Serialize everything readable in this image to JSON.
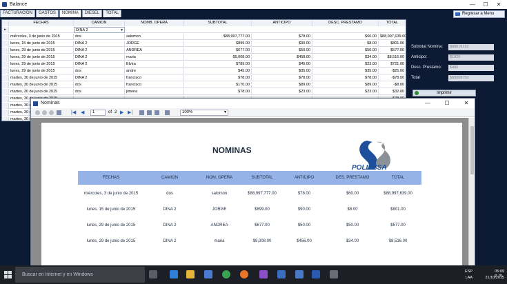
{
  "balance_window": {
    "title": "Balance",
    "tabs": [
      "FACTURACIÓN",
      "GASTOS",
      "NOMINA",
      "DIESEL",
      "TOTAL"
    ],
    "active_tab": 2,
    "regresar_label": "Regresar a Menu",
    "controls": {
      "minimize": "—",
      "maximize": "☐",
      "close": "✕"
    },
    "grid": {
      "columns": [
        "FECHAS",
        "CAMION",
        "NOMB. OPERA",
        "SUBTOTAL",
        "ANTICIPO",
        "DESC. PRESTAMO",
        "TOTAL"
      ],
      "filter_value": "DINA 2",
      "new_row_marker": "▸",
      "rows": [
        [
          "miércoles, 3 de junio de 2015",
          "dos",
          "salomon",
          "$88,997,777.00",
          "$78.00",
          "$60.00",
          "$88,997,639.00"
        ],
        [
          "lunes, 15 de junio de 2015",
          "DINA 2",
          "JORGE",
          "$899.00",
          "$90.00",
          "$8.00",
          "$801.00"
        ],
        [
          "lunes, 29 de junio de 2015",
          "DINA 2",
          "ANDREA",
          "$677.00",
          "$50.00",
          "$50.00",
          "$577.00"
        ],
        [
          "lunes, 29 de junio de 2015",
          "DINA 2",
          "maria",
          "$9,008.00",
          "$458.00",
          "$34.00",
          "$8,516.00"
        ],
        [
          "lunes, 29 de junio de 2015",
          "DINA 2",
          "Elvira",
          "$789.00",
          "$45.00",
          "$23.00",
          "$721.00"
        ],
        [
          "lunes, 29 de junio de 2015",
          "dos",
          "andre",
          "$45.00",
          "$35.00",
          "$35.00",
          "-$25.00"
        ],
        [
          "martes, 30 de junio de 2015",
          "DINA 2",
          "francisco",
          "$78.00",
          "$78.00",
          "$78.00",
          "-$78.00"
        ],
        [
          "martes, 30 de junio de 2015",
          "dos",
          "francisco",
          "$170.00",
          "$89.00",
          "$89.00",
          "-$8.00"
        ],
        [
          "martes, 30 de junio de 2015",
          "dos",
          "jimena",
          "$78.00",
          "$23.00",
          "$23.00",
          "$32.00"
        ],
        [
          "martes, 30 de junio de 2015",
          "",
          "",
          "",
          "",
          "",
          "$78.00"
        ],
        [
          "martes, 30 de junio de 2015",
          "",
          "",
          "",
          "",
          "",
          "$ 6.00"
        ],
        [
          "martes, 30 de junio de 2015",
          "",
          "",
          "",
          "",
          "",
          ""
        ],
        [
          "martes, 30 de junio de 2015",
          "",
          "",
          "",
          "",
          "",
          ""
        ]
      ]
    },
    "summary": [
      {
        "label": "Subtotal Nomina:",
        "value": "$88019132"
      },
      {
        "label": "Anticipo:",
        "value": "$1026"
      },
      {
        "label": "Desc. Prestamo:",
        "value": "$480"
      },
      {
        "label": "Total",
        "value": "$88008750"
      }
    ],
    "imprimir_label": "Imprimir"
  },
  "report_window": {
    "title": "Nominas",
    "page_current": "1",
    "page_of": "of",
    "page_total": "2",
    "zoom": "100%",
    "doc_title": "NOMINAS",
    "logo_text": "POLIESSA",
    "columns": [
      "FECHAS",
      "CAMION",
      "NOM. OPERA",
      "SUBTOTAL",
      "ANTICIPO",
      "DES. PRESTAMO",
      "TOTAL"
    ],
    "rows": [
      [
        "miércoles, 3 de junio de 2015",
        "dos",
        "salomon",
        "$88,997,777.00",
        "$78.00",
        "$60.00",
        "$88,997,639.00"
      ],
      [
        "lunes, 15 de junio de 2015",
        "DINA 2",
        "JORGE",
        "$899.00",
        "$90.00",
        "$8.00",
        "$801.00"
      ],
      [
        "lunes, 29 de junio de 2015",
        "DINA 2",
        "ANDREA",
        "$677.00",
        "$50.00",
        "$50.00",
        "$577.00"
      ],
      [
        "lunes, 29 de junio de 2015",
        "DINA 2",
        "maria",
        "$9,008.00",
        "$456.00",
        "$34.00",
        "$8,516.00"
      ]
    ]
  },
  "taskbar": {
    "search_placeholder": "Buscar en Internet y en Windows",
    "lang": "ESP",
    "lang2": "LAA",
    "time": "05:09 p. m.",
    "date": "21/10/2015"
  }
}
